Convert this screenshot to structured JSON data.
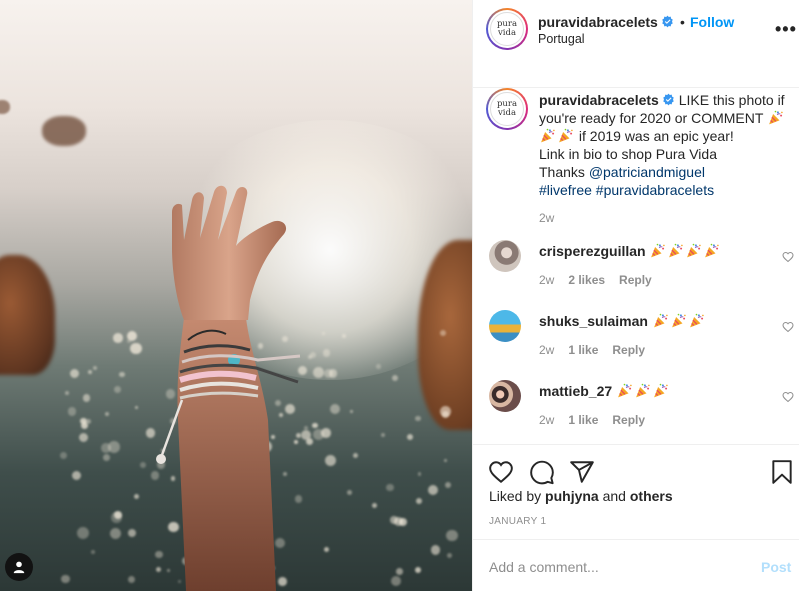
{
  "post": {
    "username": "puravidabracelets",
    "location": "Portugal",
    "follow_label": "Follow",
    "dot": "•",
    "more": "•••",
    "avatar_text": [
      "pura",
      "vida"
    ]
  },
  "caption": {
    "username": "puravidabracelets",
    "line1": "LIKE this photo if you're ready for 2020 or COMMENT",
    "line2": "if 2019 was an epic year!",
    "line3": "Link in bio to shop Pura Vida",
    "thanks": "Thanks",
    "mention": "@patriciandmiguel",
    "hashtags": "#livefree #puravidabracelets",
    "time": "2w"
  },
  "comments": [
    {
      "username": "crisperezguillan",
      "emoji_count": 4,
      "time": "2w",
      "likes": "2 likes",
      "reply": "Reply"
    },
    {
      "username": "shuks_sulaiman",
      "emoji_count": 3,
      "time": "2w",
      "likes": "1 like",
      "reply": "Reply"
    },
    {
      "username": "mattieb_27",
      "emoji_count": 3,
      "time": "2w",
      "likes": "1 like",
      "reply": "Reply"
    }
  ],
  "liked": {
    "prefix": "Liked by",
    "user": "puhjyna",
    "and": "and",
    "others": "others"
  },
  "date": "JANUARY 1",
  "add_comment": {
    "placeholder": "Add a comment...",
    "post_label": "Post"
  },
  "colors": {
    "accent": "#0095f6",
    "link": "#00376b",
    "muted": "#8e8e8e",
    "post_disabled": "#b2dffc"
  },
  "icons": [
    "verified-icon",
    "heart-icon",
    "comment-icon",
    "share-icon",
    "bookmark-icon",
    "more-icon",
    "user-tag-icon",
    "party-popper-icon"
  ]
}
